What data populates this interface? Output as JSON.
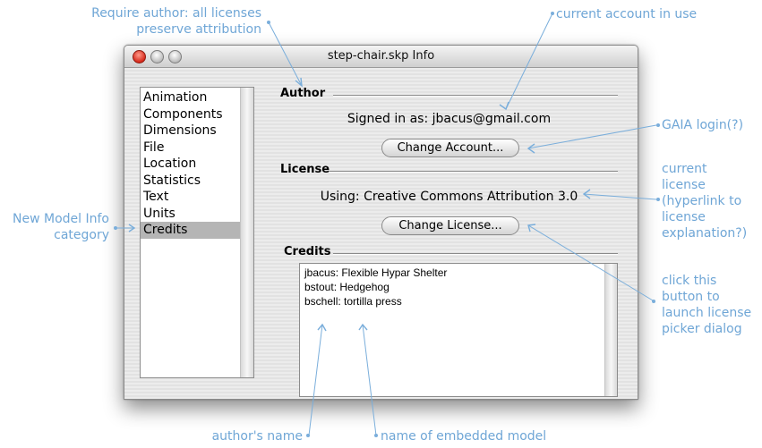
{
  "window": {
    "title": "step-chair.skp Info",
    "buttons": [
      "close-button",
      "minimize-button",
      "zoom-button"
    ]
  },
  "sidebar": {
    "items": [
      {
        "label": "Animation"
      },
      {
        "label": "Components"
      },
      {
        "label": "Dimensions"
      },
      {
        "label": "File"
      },
      {
        "label": "Location"
      },
      {
        "label": "Statistics"
      },
      {
        "label": "Text"
      },
      {
        "label": "Units"
      },
      {
        "label": "Credits",
        "selected": true
      }
    ]
  },
  "author": {
    "heading": "Author",
    "signed_in": "Signed in as: jbacus@gmail.com",
    "change_account_button": "Change Account..."
  },
  "license": {
    "heading": "License",
    "using": "Using: Creative Commons Attribution 3.0",
    "change_license_button": "Change License..."
  },
  "credits": {
    "heading": "Credits",
    "lines": [
      "jbacus: Flexible Hypar Shelter",
      "bstout: Hedgehog",
      "bschell: tortilla press"
    ]
  },
  "annotations": {
    "require_author_1": "Require author: all licenses",
    "require_author_2": "preserve attribution",
    "current_account": "current account in use",
    "gaia_login": "GAIA login(?)",
    "current_license_1": "current",
    "current_license_2": "license",
    "current_license_3": "(hyperlink to",
    "current_license_4": "license",
    "current_license_5": "explanation?)",
    "new_model_info_1": "New Model Info",
    "new_model_info_2": "category",
    "click_button_1": "click this",
    "click_button_2": "button to",
    "click_button_3": "launch license",
    "click_button_4": "picker dialog",
    "authors_name": "author's name",
    "embedded_model": "name of embedded model"
  },
  "colors": {
    "annotation": "#6fa6d6",
    "selection": "#b5b5b5",
    "close_button": "#d6281a"
  }
}
